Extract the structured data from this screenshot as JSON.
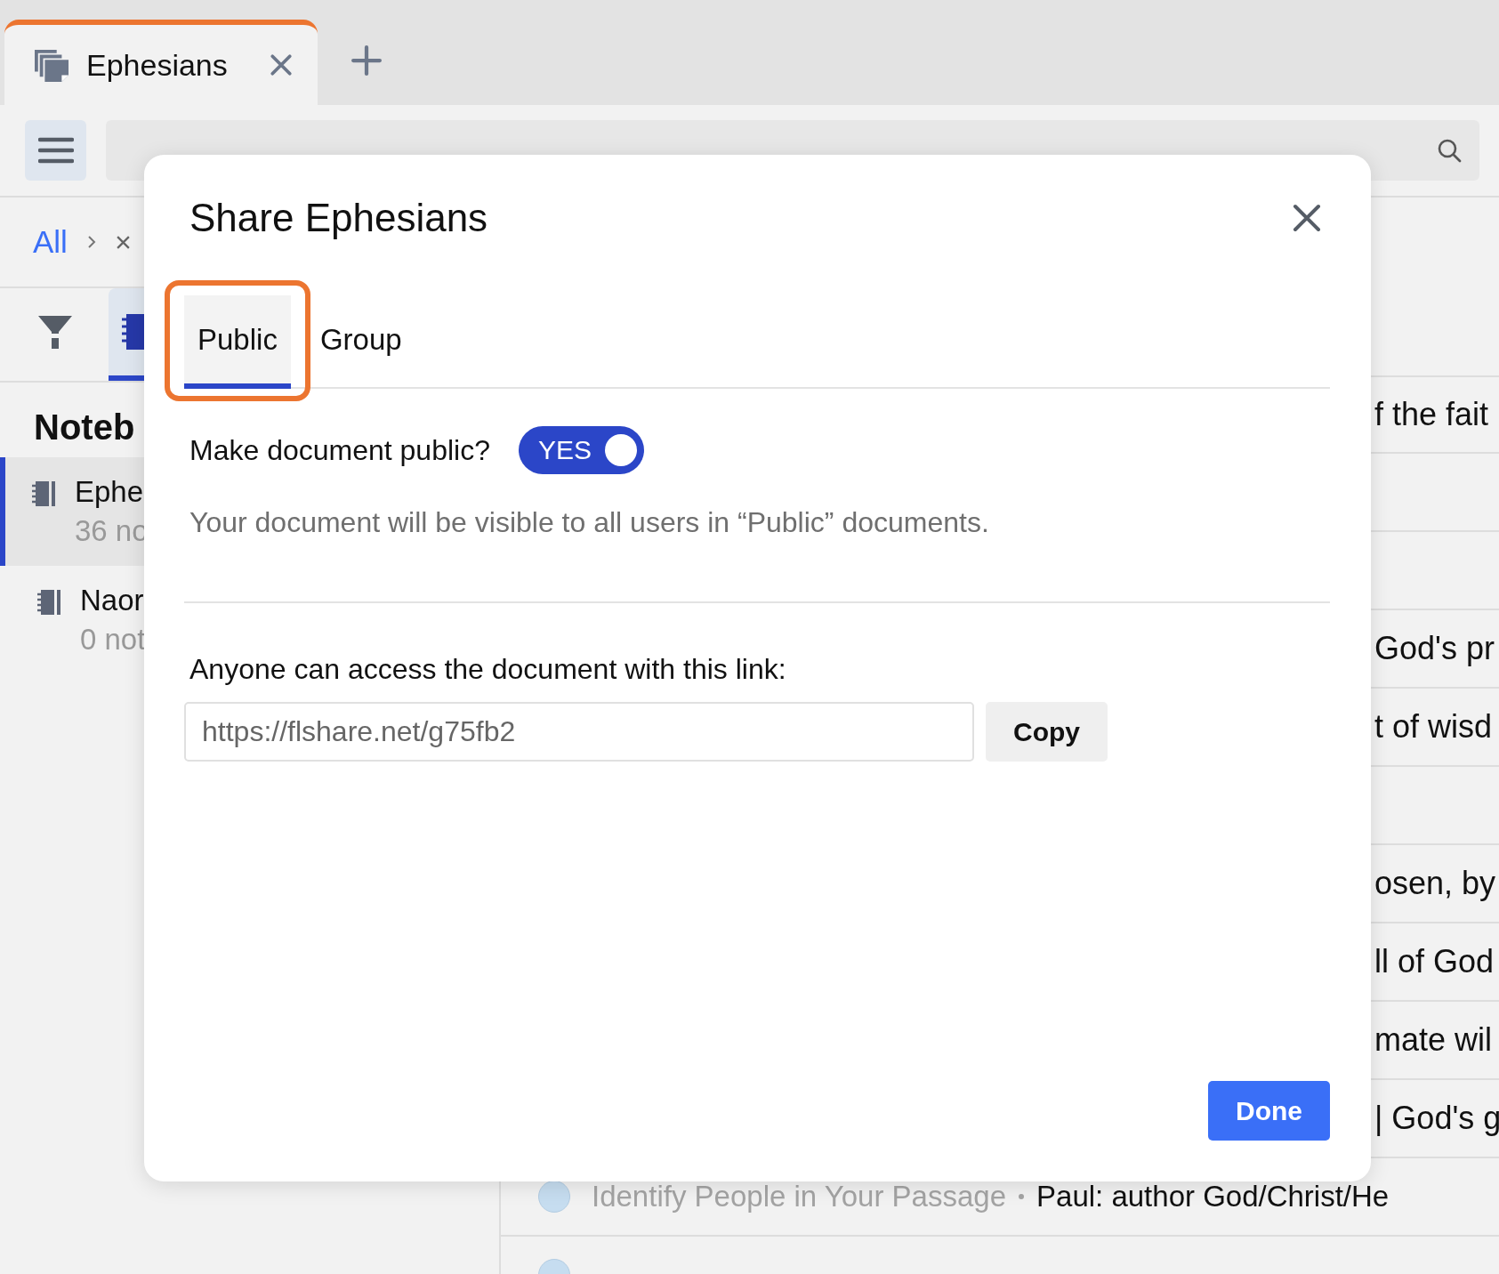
{
  "tabs": [
    {
      "title": "Ephesians",
      "selected": true
    }
  ],
  "search": {
    "kind": "text"
  },
  "breadcrumb": {
    "items": [
      "All"
    ]
  },
  "view_tabs": [
    {
      "kind": "filter",
      "selected": false
    },
    {
      "kind": "notebook",
      "selected": true
    }
  ],
  "sidebar": {
    "heading": "Noteb",
    "items": [
      {
        "title": "Ephe",
        "subtitle": "36 no",
        "selected": true
      },
      {
        "title": "Naor",
        "subtitle": "0 not",
        "selected": false
      }
    ]
  },
  "rows": [
    {
      "kind": "note",
      "text": "f the fait"
    },
    {
      "kind": "note"
    },
    {
      "kind": "note"
    },
    {
      "kind": "note",
      "text": "God's pr"
    },
    {
      "kind": "note",
      "text": "t of wisd"
    },
    {
      "kind": "note"
    },
    {
      "kind": "note",
      "text": "osen, by"
    },
    {
      "kind": "note",
      "text": "ll of God"
    },
    {
      "kind": "note",
      "text": "mate wil"
    },
    {
      "kind": "note",
      "text": "| God's g"
    },
    {
      "kind": "task",
      "label": "Identify People in Your Passage",
      "text": "Paul: author God/Christ/He"
    },
    {
      "kind": "task"
    }
  ],
  "dialog": {
    "title": "Share Ephesians",
    "tabs": [
      {
        "label": "Public",
        "selected": true,
        "highlighted": true
      },
      {
        "label": "Group",
        "selected": false,
        "highlighted": false
      }
    ],
    "public_toggle": {
      "label": "Make document public?",
      "on": true,
      "state_text": "YES"
    },
    "description": "Your document will be visible to all users in “Public” documents.",
    "link_label": "Anyone can access the document with this link:",
    "link_field": {
      "value": "https://flshare.net/g75fb2"
    },
    "copy_button": "Copy",
    "done_button": "Done"
  }
}
